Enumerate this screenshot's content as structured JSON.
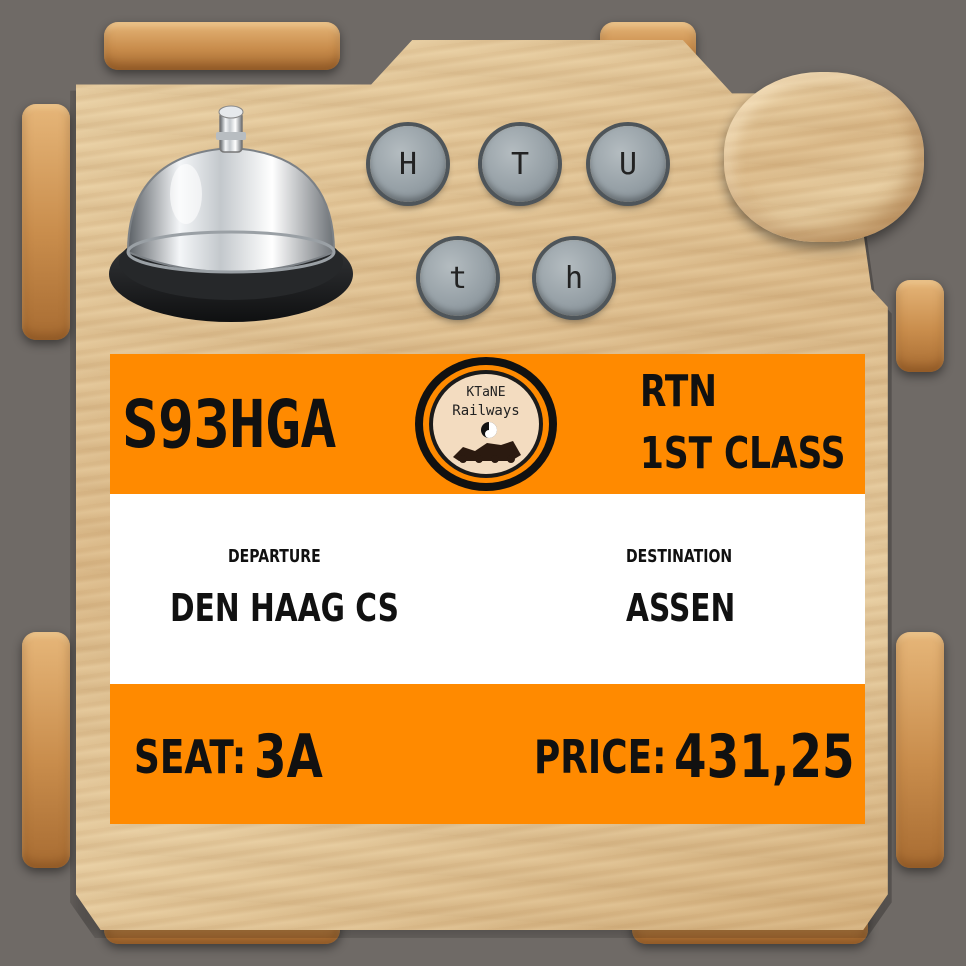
{
  "bell": {
    "icon": "service-bell-icon"
  },
  "buttons": {
    "row1": [
      "H",
      "T",
      "U"
    ],
    "row2": [
      "t",
      "h"
    ]
  },
  "ticket": {
    "code": "S93HGA",
    "logo": {
      "line1": "KTaNE",
      "line2": "Railways"
    },
    "ticket_type": "RTN",
    "travel_class": "1ST CLASS",
    "departure_label": "DEPARTURE",
    "departure_value": "DEN HAAG CS",
    "destination_label": "DESTINATION",
    "destination_value": "ASSEN",
    "seat_label": "SEAT:",
    "seat_value": "3A",
    "price_label": "PRICE:",
    "price_value": "431,25"
  },
  "colors": {
    "band": "#ff8a00",
    "background": "#6f6a66"
  }
}
